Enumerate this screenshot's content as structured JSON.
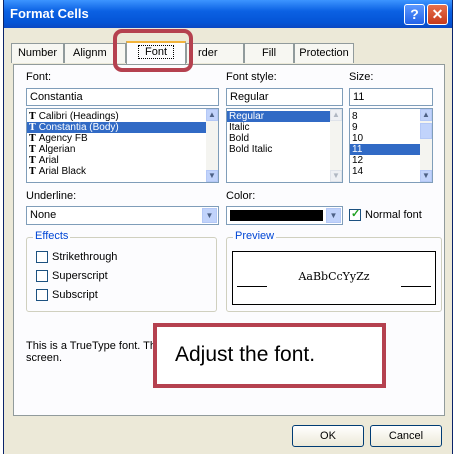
{
  "window": {
    "title": "Format Cells",
    "help_label": "?",
    "close_label": "✕"
  },
  "tabs": [
    "Number",
    "Alignment",
    "Font",
    "Border",
    "Fill",
    "Protection"
  ],
  "tabs_visible": {
    "alignment": "Alignm",
    "border": "rder"
  },
  "font": {
    "label": "Font:",
    "value": "Constantia",
    "items": [
      "Calibri (Headings)",
      "Constantia (Body)",
      "Agency FB",
      "Algerian",
      "Arial",
      "Arial Black"
    ],
    "icon": "truetype-icon",
    "icon_glyph": "T"
  },
  "font_style": {
    "label": "Font style:",
    "value": "Regular",
    "items": [
      "Regular",
      "Italic",
      "Bold",
      "Bold Italic"
    ]
  },
  "size": {
    "label": "Size:",
    "value": "11",
    "items": [
      "8",
      "9",
      "10",
      "11",
      "12",
      "14"
    ]
  },
  "underline": {
    "label": "Underline:",
    "value": "None"
  },
  "color": {
    "label": "Color:",
    "swatch": "#000000"
  },
  "normal_font": {
    "label": "Normal font",
    "checked": true
  },
  "effects": {
    "title": "Effects",
    "strikethrough": "Strikethrough",
    "superscript": "Superscript",
    "subscript": "Subscript"
  },
  "preview": {
    "title": "Preview",
    "sample": "AaBbCcYyZz"
  },
  "info_text": {
    "line1": "This is a TrueType font. Th",
    "line2": "screen."
  },
  "buttons": {
    "ok": "OK",
    "cancel": "Cancel"
  },
  "callout": {
    "text": "Adjust the font."
  },
  "colors": {
    "accent": "#b5414f",
    "title_bar": "#0b61e3",
    "selection": "#316ac5"
  }
}
